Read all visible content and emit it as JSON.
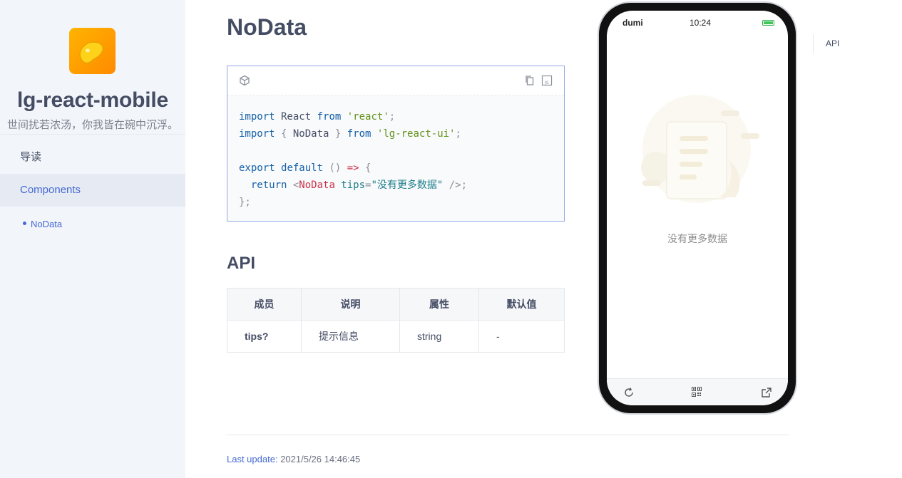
{
  "site": {
    "title": "lg-react-mobile",
    "description": "世间扰若浓汤，你我皆在碗中沉浮。"
  },
  "nav": {
    "items": [
      {
        "label": "导读"
      },
      {
        "label": "Components"
      }
    ],
    "sub_items": [
      {
        "label": "NoData"
      }
    ]
  },
  "page": {
    "title": "NoData"
  },
  "demo": {
    "code": {
      "line1": {
        "k1": "import",
        "t1": " React ",
        "k2": "from",
        "s1": "'react'",
        "p1": ";"
      },
      "line2": {
        "k1": "import",
        "p0": " { ",
        "t1": "NoData",
        "p1": " } ",
        "k2": "from",
        "s1": "'lg-react-ui'",
        "p2": ";"
      },
      "line4": {
        "k1": "export",
        "k2": "default",
        "p1": " () ",
        "k3": "=>",
        "p2": " {"
      },
      "line5": {
        "k1": "return",
        "p1": " <",
        "tag": "NoData",
        "attr": " tips",
        "p2": "=",
        "s1": "\"没有更多数据\"",
        "p3": " />",
        "p4": ";"
      },
      "line6": {
        "p1": "};"
      }
    }
  },
  "api": {
    "title": "API",
    "columns": [
      "成员",
      "说明",
      "属性",
      "默认值"
    ],
    "rows": [
      [
        "tips?",
        "提示信息",
        "string",
        "-"
      ]
    ]
  },
  "footer": {
    "label": "Last update:",
    "value": "2021/5/26 14:46:45"
  },
  "phone": {
    "brand": "dumi",
    "time": "10:24",
    "tips": "没有更多数据"
  },
  "toc": {
    "items": [
      {
        "label": "API"
      }
    ]
  },
  "colors": {
    "accent": "#4569d4",
    "sidebar_bg": "#f2f5fa",
    "logo": "#ff9f00"
  },
  "icons": [
    "codesandbox-icon",
    "copy-icon",
    "js-icon",
    "refresh-icon",
    "qrcode-icon",
    "external-link-icon",
    "battery-icon"
  ]
}
